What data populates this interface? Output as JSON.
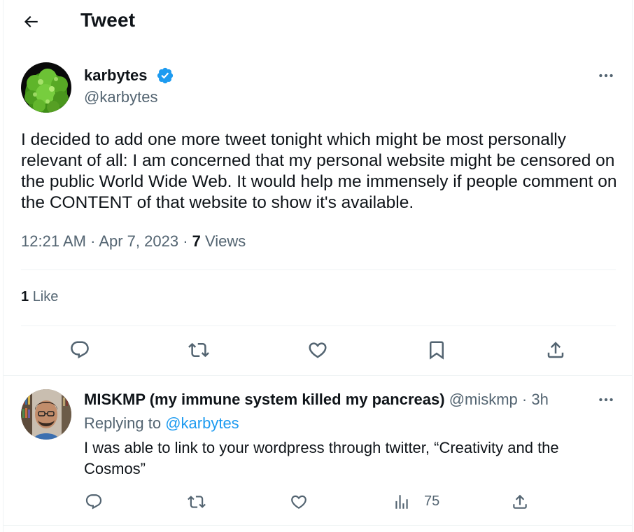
{
  "header": {
    "title": "Tweet"
  },
  "tweet": {
    "display_name": "karbytes",
    "handle": "@karbytes",
    "text": "I decided to add one more tweet tonight which might be most personally relevant of all: I am concerned that my personal website might be censored on the public World Wide Web. It would help me immensely if people comment on the CONTENT of that website to show it's available.",
    "time": "12:21 AM",
    "date": "Apr 7, 2023",
    "views_count": "7",
    "views_label": "Views",
    "likes_count": "1",
    "likes_label": "Like",
    "icons": [
      "back-arrow-icon",
      "verified-badge-icon",
      "more-icon",
      "reply-icon",
      "retweet-icon",
      "like-icon",
      "bookmark-icon",
      "share-icon"
    ]
  },
  "reply": {
    "display_name": "MISKMP (my immune system killed my pancreas)",
    "handle": "@miskmp",
    "age": "3h",
    "replying_prefix": "Replying to",
    "replying_to": "@karbytes",
    "text": "I was able to link to your wordpress through twitter, “Creativity and the Cosmos”",
    "views": "75",
    "icons": [
      "reply-icon",
      "retweet-icon",
      "like-icon",
      "views-icon",
      "share-icon"
    ]
  },
  "colors": {
    "text": "#0f1419",
    "secondary": "#536471",
    "accent": "#1d9bf0",
    "divider": "#eff3f4"
  }
}
